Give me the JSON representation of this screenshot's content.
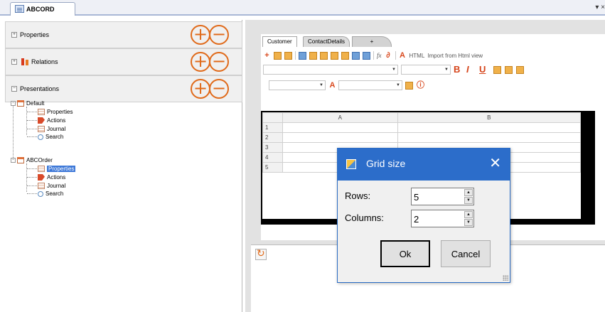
{
  "document_tab": {
    "title": "ABCORD",
    "window_controls": "▾ ×"
  },
  "left_panel": {
    "sections": [
      {
        "label": "Properties"
      },
      {
        "label": "Relations"
      },
      {
        "label": "Presentations"
      }
    ],
    "tree": {
      "default": {
        "label": "Default",
        "children": [
          "Properties",
          "Actions",
          "Journal",
          "Search"
        ]
      },
      "abcorder": {
        "label": "ABCOrder",
        "children": [
          "Properties",
          "Actions",
          "Journal",
          "Search"
        ],
        "selected": "Properties"
      }
    }
  },
  "designer": {
    "tabs": [
      "Customer",
      "ContactDetails",
      "+"
    ],
    "toolbar": {
      "html_label": "HTML",
      "import_label": "Import from Html view",
      "fx_label": "fx",
      "bold": "B",
      "italic": "I",
      "underline": "U"
    },
    "sheet": {
      "columns": [
        "A",
        "B"
      ],
      "rows": [
        "1",
        "2",
        "3",
        "4",
        "5"
      ]
    }
  },
  "dialog": {
    "title": "Grid size",
    "close_glyph": "✕",
    "rows_label": "Rows:",
    "rows_value": "5",
    "columns_label": "Columns:",
    "columns_value": "2",
    "ok_label": "Ok",
    "cancel_label": "Cancel"
  },
  "colors": {
    "accent": "#2c6dca",
    "plus_minus": "#e06a1a",
    "selection": "#3d78d8"
  }
}
